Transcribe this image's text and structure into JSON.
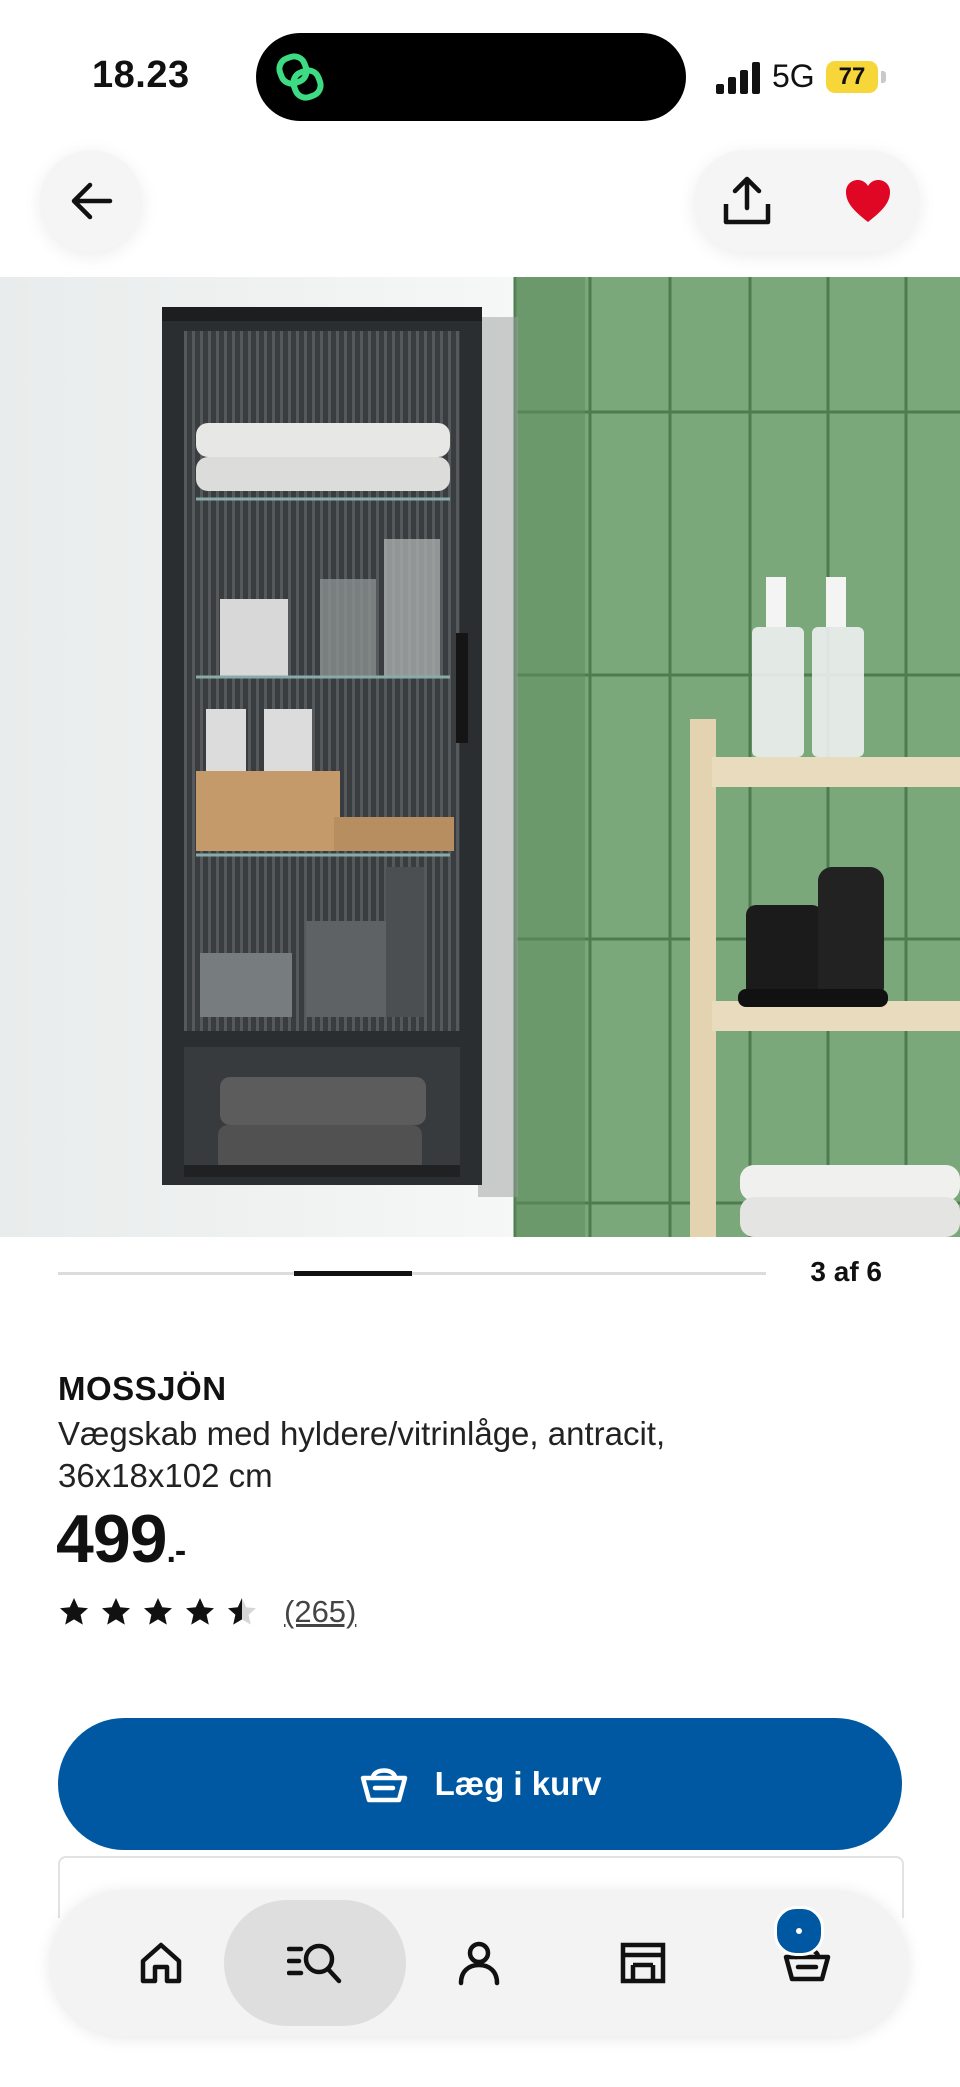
{
  "status_bar": {
    "time": "18.23",
    "network": "5G",
    "battery": "77",
    "battery_color": "#f7d63a"
  },
  "top_bar": {
    "back_icon": "arrow-left-icon",
    "share_icon": "share-icon",
    "favourite_icon": "heart-icon",
    "favourite_color": "#e00724"
  },
  "gallery": {
    "counter": "3 af 6",
    "current": 3,
    "total": 6
  },
  "product": {
    "name": "MOSSJÖN",
    "description": "Vægskab med hyldere/vitrinlåge, antracit, 36x18x102 cm",
    "price": "499",
    "price_suffix": ".-",
    "rating": 4.5,
    "max_rating": 5,
    "reviews": "(265)"
  },
  "actions": {
    "add_to_cart": "Læg i kurv",
    "accent_color": "#0058a3"
  },
  "bottom_nav": {
    "items": [
      {
        "icon": "home-icon"
      },
      {
        "icon": "search-icon",
        "active": true
      },
      {
        "icon": "profile-icon"
      },
      {
        "icon": "store-icon"
      },
      {
        "icon": "basket-icon"
      }
    ]
  }
}
